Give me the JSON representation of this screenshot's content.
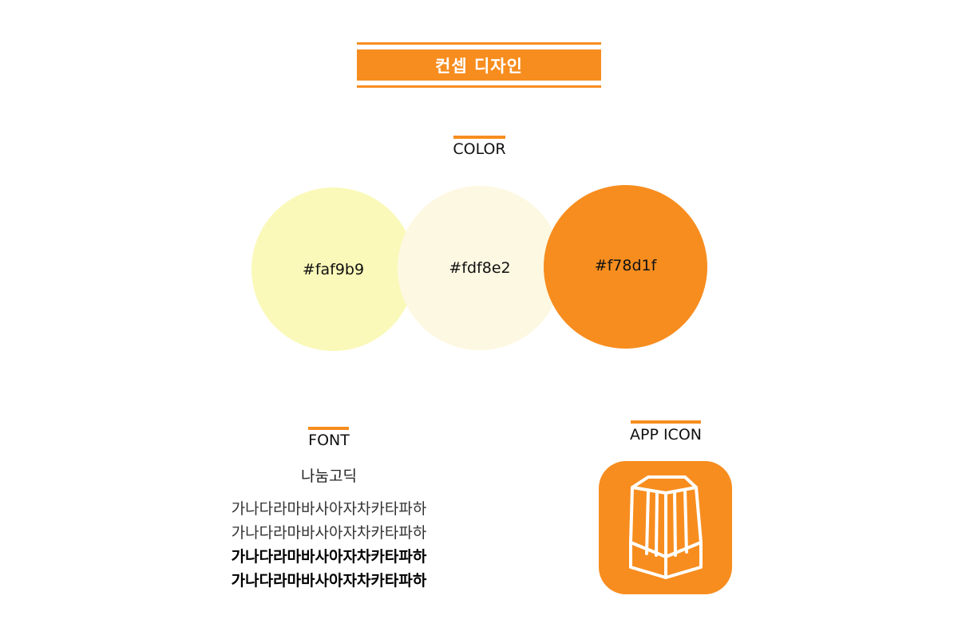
{
  "header": {
    "title": "컨셉 디자인"
  },
  "color_section": {
    "title": "COLOR",
    "swatches": [
      {
        "label": "#faf9b9",
        "color": "#faf9b9"
      },
      {
        "label": "#fdf8e2",
        "color": "#fdf8e2"
      },
      {
        "label": "#f78d1f",
        "color": "#f78d1f"
      }
    ]
  },
  "font_section": {
    "title": "FONT",
    "font_name": "나눔고딕",
    "samples": [
      "가나다라마바사아자차카타파하",
      "가나다라마바사아자차카타파하",
      "가나다라마바사아자차카타파하",
      "가나다라마바사아자차카타파하"
    ]
  },
  "app_icon_section": {
    "title": "APP ICON",
    "icon": "lantern-icon",
    "background": "#f78d1f"
  },
  "theme": {
    "accent": "#f78d1f"
  }
}
